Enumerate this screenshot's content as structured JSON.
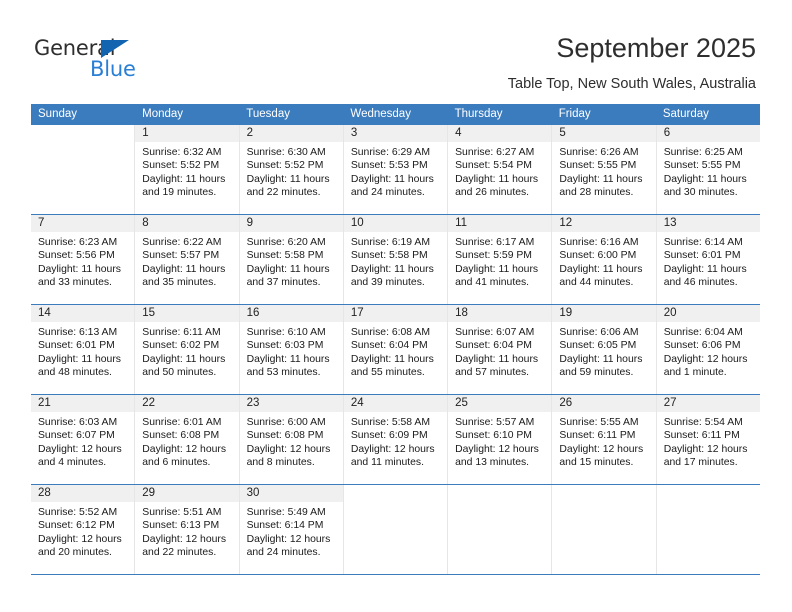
{
  "brand": {
    "name_part1": "General",
    "name_part2": "Blue",
    "triangle_color": "#1263b0",
    "blue_color": "#2a7fd4"
  },
  "header": {
    "title": "September 2025",
    "subtitle": "Table Top, New South Wales, Australia"
  },
  "theme": {
    "header_bg": "#3b7cbf",
    "header_text": "#ffffff",
    "daynum_band_bg": "#f0f0f0",
    "row_divider": "#3b7cbf",
    "col_divider": "#e6e6e6"
  },
  "weekday_headers": [
    "Sunday",
    "Monday",
    "Tuesday",
    "Wednesday",
    "Thursday",
    "Friday",
    "Saturday"
  ],
  "weeks": [
    [
      {
        "day": "",
        "lines": []
      },
      {
        "day": "1",
        "lines": [
          "Sunrise: 6:32 AM",
          "Sunset: 5:52 PM",
          "Daylight: 11 hours",
          "and 19 minutes."
        ]
      },
      {
        "day": "2",
        "lines": [
          "Sunrise: 6:30 AM",
          "Sunset: 5:52 PM",
          "Daylight: 11 hours",
          "and 22 minutes."
        ]
      },
      {
        "day": "3",
        "lines": [
          "Sunrise: 6:29 AM",
          "Sunset: 5:53 PM",
          "Daylight: 11 hours",
          "and 24 minutes."
        ]
      },
      {
        "day": "4",
        "lines": [
          "Sunrise: 6:27 AM",
          "Sunset: 5:54 PM",
          "Daylight: 11 hours",
          "and 26 minutes."
        ]
      },
      {
        "day": "5",
        "lines": [
          "Sunrise: 6:26 AM",
          "Sunset: 5:55 PM",
          "Daylight: 11 hours",
          "and 28 minutes."
        ]
      },
      {
        "day": "6",
        "lines": [
          "Sunrise: 6:25 AM",
          "Sunset: 5:55 PM",
          "Daylight: 11 hours",
          "and 30 minutes."
        ]
      }
    ],
    [
      {
        "day": "7",
        "lines": [
          "Sunrise: 6:23 AM",
          "Sunset: 5:56 PM",
          "Daylight: 11 hours",
          "and 33 minutes."
        ]
      },
      {
        "day": "8",
        "lines": [
          "Sunrise: 6:22 AM",
          "Sunset: 5:57 PM",
          "Daylight: 11 hours",
          "and 35 minutes."
        ]
      },
      {
        "day": "9",
        "lines": [
          "Sunrise: 6:20 AM",
          "Sunset: 5:58 PM",
          "Daylight: 11 hours",
          "and 37 minutes."
        ]
      },
      {
        "day": "10",
        "lines": [
          "Sunrise: 6:19 AM",
          "Sunset: 5:58 PM",
          "Daylight: 11 hours",
          "and 39 minutes."
        ]
      },
      {
        "day": "11",
        "lines": [
          "Sunrise: 6:17 AM",
          "Sunset: 5:59 PM",
          "Daylight: 11 hours",
          "and 41 minutes."
        ]
      },
      {
        "day": "12",
        "lines": [
          "Sunrise: 6:16 AM",
          "Sunset: 6:00 PM",
          "Daylight: 11 hours",
          "and 44 minutes."
        ]
      },
      {
        "day": "13",
        "lines": [
          "Sunrise: 6:14 AM",
          "Sunset: 6:01 PM",
          "Daylight: 11 hours",
          "and 46 minutes."
        ]
      }
    ],
    [
      {
        "day": "14",
        "lines": [
          "Sunrise: 6:13 AM",
          "Sunset: 6:01 PM",
          "Daylight: 11 hours",
          "and 48 minutes."
        ]
      },
      {
        "day": "15",
        "lines": [
          "Sunrise: 6:11 AM",
          "Sunset: 6:02 PM",
          "Daylight: 11 hours",
          "and 50 minutes."
        ]
      },
      {
        "day": "16",
        "lines": [
          "Sunrise: 6:10 AM",
          "Sunset: 6:03 PM",
          "Daylight: 11 hours",
          "and 53 minutes."
        ]
      },
      {
        "day": "17",
        "lines": [
          "Sunrise: 6:08 AM",
          "Sunset: 6:04 PM",
          "Daylight: 11 hours",
          "and 55 minutes."
        ]
      },
      {
        "day": "18",
        "lines": [
          "Sunrise: 6:07 AM",
          "Sunset: 6:04 PM",
          "Daylight: 11 hours",
          "and 57 minutes."
        ]
      },
      {
        "day": "19",
        "lines": [
          "Sunrise: 6:06 AM",
          "Sunset: 6:05 PM",
          "Daylight: 11 hours",
          "and 59 minutes."
        ]
      },
      {
        "day": "20",
        "lines": [
          "Sunrise: 6:04 AM",
          "Sunset: 6:06 PM",
          "Daylight: 12 hours",
          "and 1 minute."
        ]
      }
    ],
    [
      {
        "day": "21",
        "lines": [
          "Sunrise: 6:03 AM",
          "Sunset: 6:07 PM",
          "Daylight: 12 hours",
          "and 4 minutes."
        ]
      },
      {
        "day": "22",
        "lines": [
          "Sunrise: 6:01 AM",
          "Sunset: 6:08 PM",
          "Daylight: 12 hours",
          "and 6 minutes."
        ]
      },
      {
        "day": "23",
        "lines": [
          "Sunrise: 6:00 AM",
          "Sunset: 6:08 PM",
          "Daylight: 12 hours",
          "and 8 minutes."
        ]
      },
      {
        "day": "24",
        "lines": [
          "Sunrise: 5:58 AM",
          "Sunset: 6:09 PM",
          "Daylight: 12 hours",
          "and 11 minutes."
        ]
      },
      {
        "day": "25",
        "lines": [
          "Sunrise: 5:57 AM",
          "Sunset: 6:10 PM",
          "Daylight: 12 hours",
          "and 13 minutes."
        ]
      },
      {
        "day": "26",
        "lines": [
          "Sunrise: 5:55 AM",
          "Sunset: 6:11 PM",
          "Daylight: 12 hours",
          "and 15 minutes."
        ]
      },
      {
        "day": "27",
        "lines": [
          "Sunrise: 5:54 AM",
          "Sunset: 6:11 PM",
          "Daylight: 12 hours",
          "and 17 minutes."
        ]
      }
    ],
    [
      {
        "day": "28",
        "lines": [
          "Sunrise: 5:52 AM",
          "Sunset: 6:12 PM",
          "Daylight: 12 hours",
          "and 20 minutes."
        ]
      },
      {
        "day": "29",
        "lines": [
          "Sunrise: 5:51 AM",
          "Sunset: 6:13 PM",
          "Daylight: 12 hours",
          "and 22 minutes."
        ]
      },
      {
        "day": "30",
        "lines": [
          "Sunrise: 5:49 AM",
          "Sunset: 6:14 PM",
          "Daylight: 12 hours",
          "and 24 minutes."
        ]
      },
      {
        "day": "",
        "lines": []
      },
      {
        "day": "",
        "lines": []
      },
      {
        "day": "",
        "lines": []
      },
      {
        "day": "",
        "lines": []
      }
    ]
  ]
}
